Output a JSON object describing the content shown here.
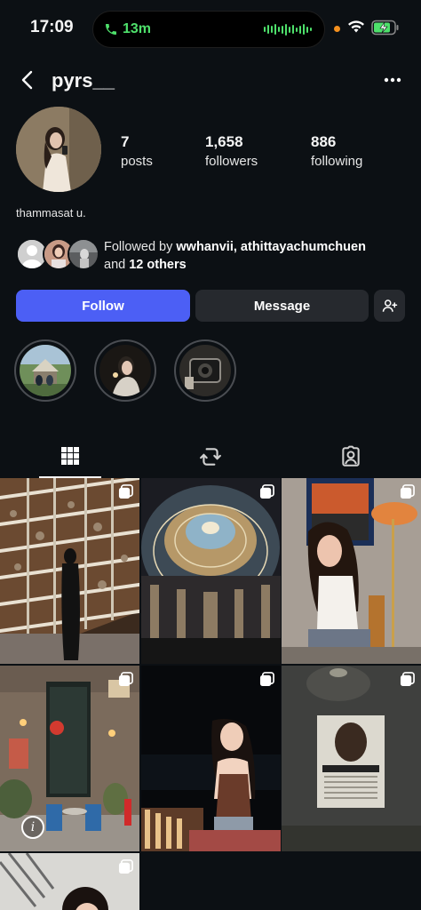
{
  "status_bar": {
    "time": "17:09",
    "call_duration": "13m",
    "call_color": "#4ee06b",
    "privacy_dot_color": "#f4901e"
  },
  "header": {
    "username": "pyrs__",
    "back_icon": "chevron-left-icon",
    "more_icon": "more-horizontal-icon"
  },
  "profile": {
    "stats": [
      {
        "value": "7",
        "label": "posts"
      },
      {
        "value": "1,658",
        "label": "followers"
      },
      {
        "value": "886",
        "label": "following"
      }
    ],
    "bio": "thammasat u.",
    "followed_by": {
      "prefix": "Followed by ",
      "names": "wwhanvii, athittayachumchuen",
      "and": " and ",
      "others": "12 others"
    }
  },
  "actions": {
    "follow_label": "Follow",
    "message_label": "Message",
    "add_user_icon": "add-person-icon",
    "follow_color": "#4c5ff5"
  },
  "highlights": [
    {
      "name": "highlight-1"
    },
    {
      "name": "highlight-2"
    },
    {
      "name": "highlight-3"
    }
  ],
  "tabs": [
    {
      "name": "grid-icon",
      "active": true
    },
    {
      "name": "reels-repost-icon",
      "active": false
    },
    {
      "name": "tagged-icon",
      "active": false
    }
  ],
  "posts": [
    {
      "name": "post-1",
      "multi": true
    },
    {
      "name": "post-2",
      "multi": true
    },
    {
      "name": "post-3",
      "multi": true
    },
    {
      "name": "post-4",
      "multi": true
    },
    {
      "name": "post-5",
      "multi": true
    },
    {
      "name": "post-6",
      "multi": true
    },
    {
      "name": "post-7",
      "multi": true
    }
  ]
}
